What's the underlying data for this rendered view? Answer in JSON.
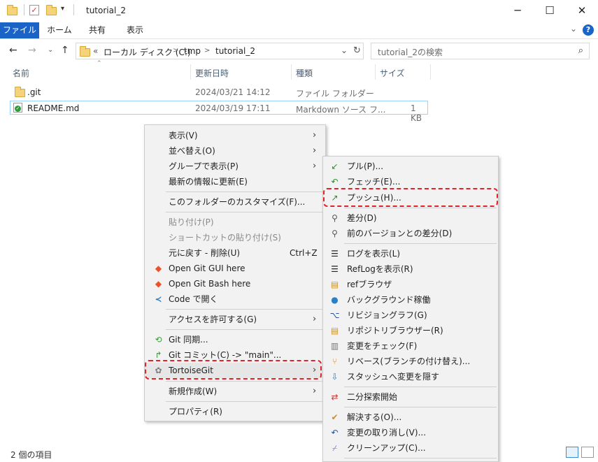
{
  "window": {
    "title": "tutorial_2",
    "minimize": "─",
    "maximize": "☐",
    "close": "✕"
  },
  "ribbon": {
    "tabs": [
      "ファイル",
      "ホーム",
      "共有",
      "表示"
    ]
  },
  "address": {
    "prefix": "«",
    "crumbs": [
      "ローカル ディスク (C:)",
      "tmp",
      "tutorial_2"
    ],
    "separator": ">"
  },
  "search": {
    "placeholder": "tutorial_2の検索"
  },
  "columns": [
    "名前",
    "更新日時",
    "種類",
    "サイズ"
  ],
  "files": [
    {
      "name": ".git",
      "date": "2024/03/21 14:12",
      "type": "ファイル フォルダー",
      "size": ""
    },
    {
      "name": "README.md",
      "date": "2024/03/19 17:11",
      "type": "Markdown ソース フ...",
      "size": "1 KB"
    }
  ],
  "status": {
    "item_count": "2 個の項目"
  },
  "context_menu": {
    "view": "表示(V)",
    "sort": "並べ替え(O)",
    "group": "グループで表示(P)",
    "refresh": "最新の情報に更新(E)",
    "customize": "このフォルダーのカスタマイズ(F)...",
    "paste": "貼り付け(P)",
    "paste_shortcut": "ショートカットの貼り付け(S)",
    "undo": "元に戻す - 削除(U)",
    "undo_shortcut": "Ctrl+Z",
    "git_gui": "Open Git GUI here",
    "git_bash": "Open Git Bash here",
    "code": "Code で開く",
    "access": "アクセスを許可する(G)",
    "git_sync": "Git 同期...",
    "git_commit": "Git コミット(C) -> \"main\"...",
    "tortoise": "TortoiseGit",
    "new": "新規作成(W)",
    "properties": "プロパティ(R)"
  },
  "submenu": {
    "pull": "プル(P)...",
    "fetch": "フェッチ(E)...",
    "push": "プッシュ(H)...",
    "diff": "差分(D)",
    "diff_prev": "前のバージョンとの差分(D)",
    "log": "ログを表示(L)",
    "reflog": "RefLogを表示(R)",
    "refbrowser": "refブラウザ",
    "bgjob": "バックグラウンド稼働",
    "revgraph": "リビジョングラフ(G)",
    "repobrowser": "リポジトリブラウザー(R)",
    "checkmod": "変更をチェック(F)",
    "rebase": "リベース(ブランチの付け替え)...",
    "stash": "スタッシュへ変更を隠す",
    "bisect": "二分探索開始",
    "resolve": "解決する(O)...",
    "revert": "変更の取り消し(V)...",
    "cleanup": "クリーンアップ(C)..."
  },
  "colors": {
    "accent": "#1a64c8",
    "highlight": "#e0222a",
    "selection_border": "#99d1ff"
  }
}
